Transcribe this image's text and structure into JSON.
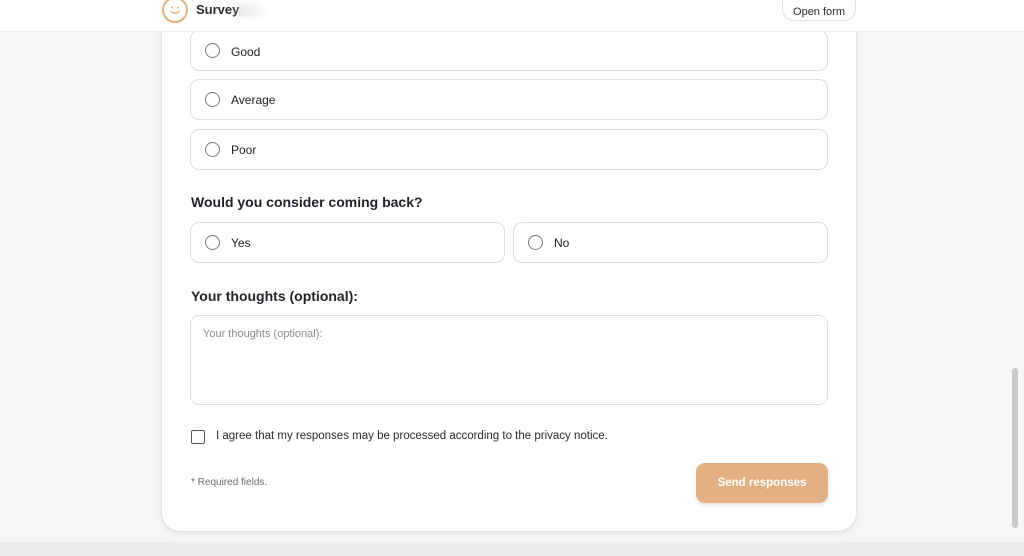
{
  "header": {
    "brand": "Survey",
    "open_form_label": "Open form",
    "logo_icon": "smiley-icon",
    "accent": "#e0b27f"
  },
  "quality_question": {
    "options": [
      {
        "label": "Good"
      },
      {
        "label": "Average"
      },
      {
        "label": "Poor"
      }
    ]
  },
  "return_question": {
    "title": "Would you consider coming back?",
    "options": [
      {
        "label": "Yes"
      },
      {
        "label": "No"
      }
    ]
  },
  "thoughts": {
    "title": "Your thoughts (optional):",
    "placeholder": "Your thoughts (optional):"
  },
  "consent": {
    "label": "I agree that my responses may be processed according to the privacy notice.",
    "checked": false
  },
  "footer": {
    "required_note": "* Required fields.",
    "submit_label": "Send responses",
    "submit_color": "#e3b083"
  }
}
